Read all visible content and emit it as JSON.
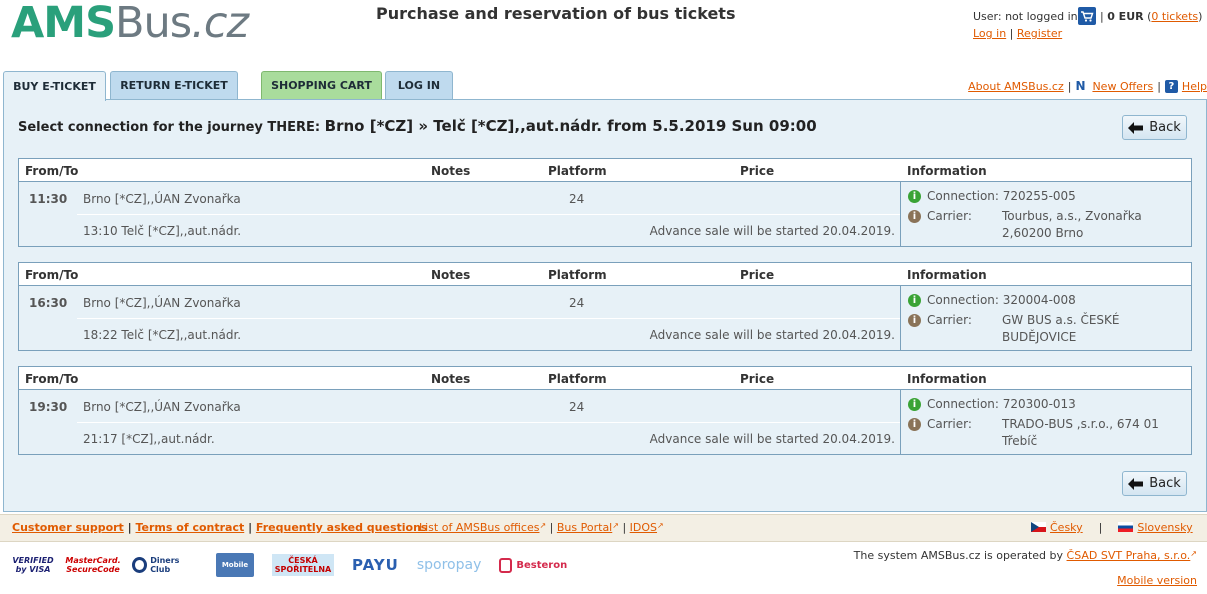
{
  "header": {
    "logo_ams": "AMS",
    "logo_bus": "Bus",
    "logo_cz": ".cz",
    "site_title": "Purchase and reservation of bus tickets",
    "user_status": "User: not logged in",
    "cart_amount": "0 EUR",
    "cart_tickets": "0 tickets",
    "login_label": "Log in",
    "register_label": "Register"
  },
  "tabs": [
    {
      "label": "BUY E-TICKET",
      "active": true
    },
    {
      "label": "RETURN E-TICKET",
      "active": false
    },
    {
      "label": "SHOPPING CART",
      "active": false
    },
    {
      "label": "LOG IN",
      "active": false
    }
  ],
  "top_links": {
    "about": "About AMSBus.cz",
    "new_offers": "New Offers",
    "help": "Help"
  },
  "journey": {
    "prefix": "Select connection for the journey THERE:",
    "route": "Brno [*CZ] » Telč [*CZ],,aut.nádr. from 5.5.2019 Sun 09:00",
    "back_label": "Back"
  },
  "table_headers": {
    "from_to": "From/To",
    "notes": "Notes",
    "platform": "Platform",
    "price": "Price",
    "information": "Information"
  },
  "connections": [
    {
      "dep_time": "11:30",
      "dep_stop": "Brno [*CZ],,ÚAN Zvonařka",
      "platform": "24",
      "arr": "13:10 Telč [*CZ],,aut.nádr.",
      "advance": "Advance sale will be started 20.04.2019.",
      "connection": "Connection: 720255-005",
      "carrier_label": "Carrier:",
      "carrier": "Tourbus, a.s., Zvonařka 2,60200 Brno"
    },
    {
      "dep_time": "16:30",
      "dep_stop": "Brno [*CZ],,ÚAN Zvonařka",
      "platform": "24",
      "arr": "18:22 Telč [*CZ],,aut.nádr.",
      "advance": "Advance sale will be started 20.04.2019.",
      "connection": "Connection: 320004-008",
      "carrier_label": "Carrier:",
      "carrier": "GW BUS a.s. ČESKÉ BUDĚJOVICE"
    },
    {
      "dep_time": "19:30",
      "dep_stop": "Brno [*CZ],,ÚAN Zvonařka",
      "platform": "24",
      "arr": "21:17 [*CZ],,aut.nádr.",
      "advance": "Advance sale will be started 20.04.2019.",
      "connection": "Connection: 720300-013",
      "carrier_label": "Carrier:",
      "carrier": "TRADO-BUS ,s.r.o., 674 01 Třebíč"
    }
  ],
  "footer": {
    "customer_support": "Customer support",
    "terms": "Terms of contract",
    "faq": "Frequently asked questions",
    "offices": "List of AMSBus offices",
    "bus_portal": "Bus Portal",
    "idos": "IDOS",
    "lang_cz": "Česky",
    "lang_sk": "Slovensky",
    "operator_prefix": "The system AMSBus.cz is operated by",
    "operator_link": "ČSAD SVT Praha, s.r.o.",
    "mobile_version": "Mobile version"
  },
  "payments": {
    "visa_line1": "VERIFIED",
    "visa_line2": "by VISA",
    "mc_line1": "MasterCard.",
    "mc_line2": "SecureCode",
    "diners": "Diners Club",
    "mobile": "Mobile",
    "cs_line1": "ČESKÁ",
    "cs_line2": "SPOŘITELNA",
    "payu": "PAYU",
    "sporo": "sporo",
    "sporo_pay": "pay",
    "besteron": "Besteron"
  },
  "colors": {
    "brand_green": "#2aa07b",
    "link_orange": "#e05a00",
    "panel_blue": "#e7f1f7",
    "cart_tab_green": "#a9dc9c"
  }
}
